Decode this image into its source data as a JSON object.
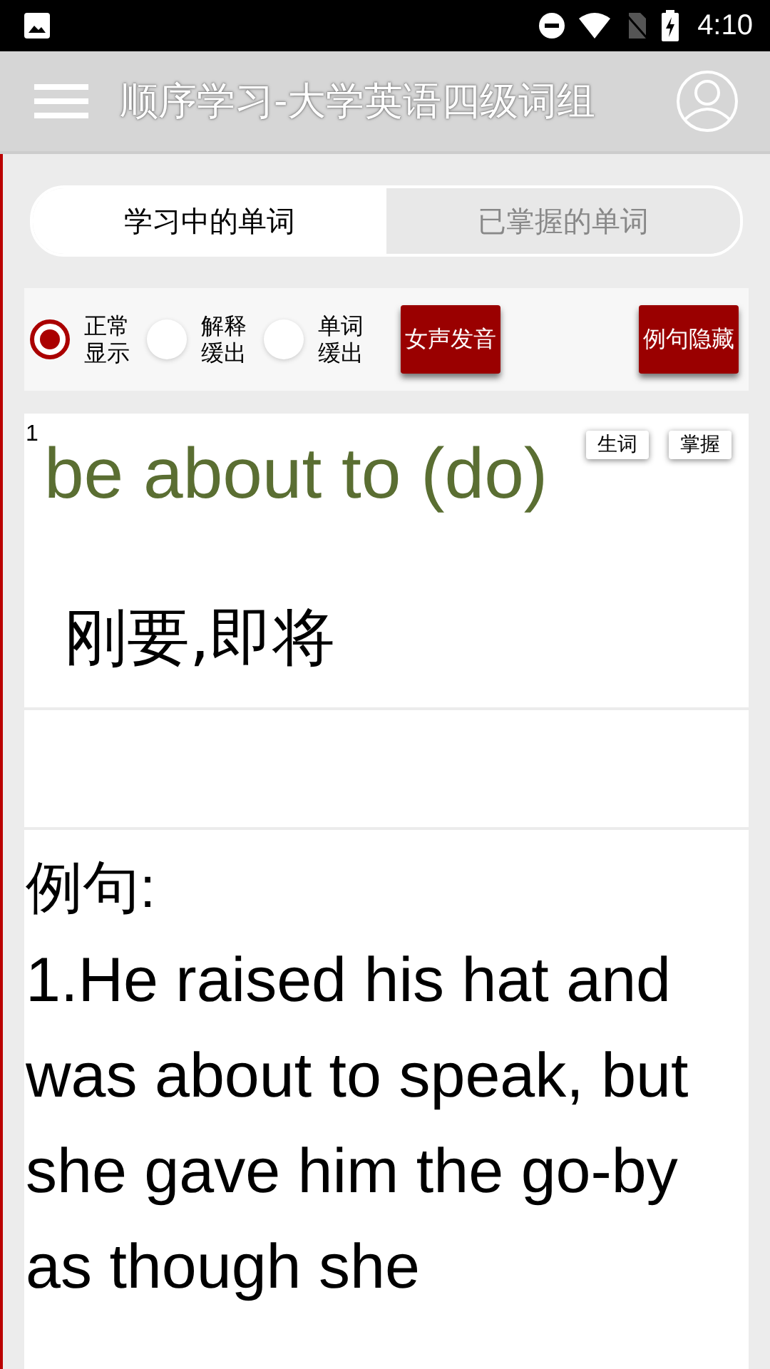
{
  "status_bar": {
    "time": "4:10"
  },
  "toolbar": {
    "title": "顺序学习-大学英语四级词组"
  },
  "tabs": [
    {
      "label": "学习中的单词",
      "selected": true
    },
    {
      "label": "已掌握的单词",
      "selected": false
    }
  ],
  "display_modes": [
    {
      "label": "正常显示",
      "selected": true
    },
    {
      "label": "解释缓出",
      "selected": false
    },
    {
      "label": "单词缓出",
      "selected": false
    }
  ],
  "action_buttons": [
    "女声发音",
    "例句隐藏"
  ],
  "word_card": {
    "index": "1",
    "word": "be about to (do)",
    "meaning": "刚要,即将",
    "tag_buttons": [
      "生词",
      "掌握"
    ]
  },
  "examples": {
    "heading": "例句:",
    "text": "1.He raised his hat and was about to speak, but she gave him the go-by as though she"
  }
}
